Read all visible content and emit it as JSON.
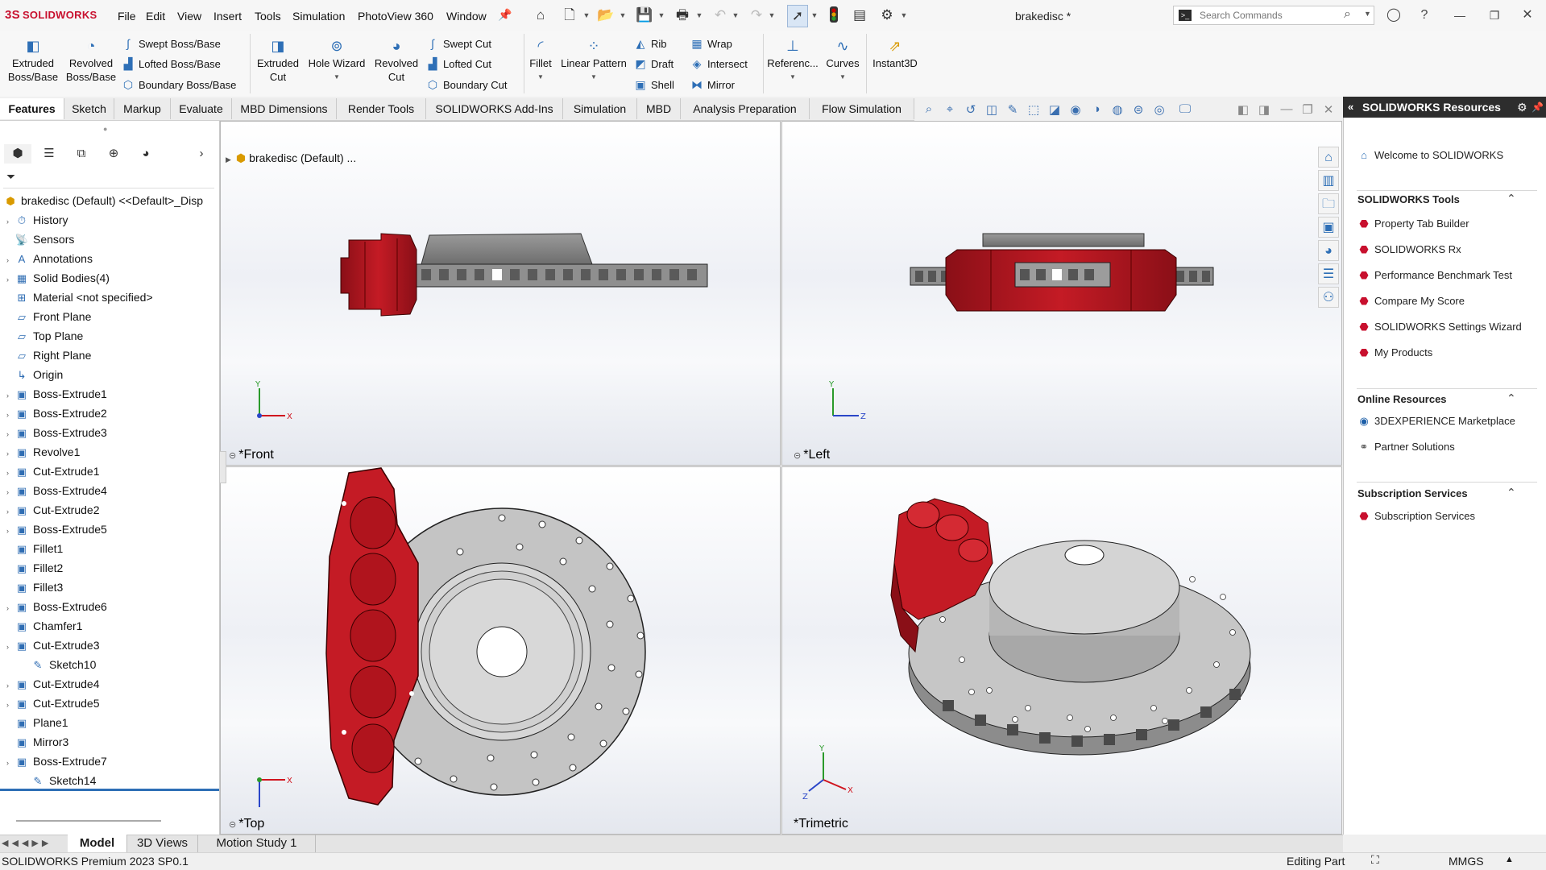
{
  "app": {
    "logo_prefix": "3S",
    "logo": "SOLIDWORKS",
    "doc_title": "brakedisc *",
    "search_placeholder": "Search Commands"
  },
  "menu": [
    "File",
    "Edit",
    "View",
    "Insert",
    "Tools",
    "Simulation",
    "PhotoView 360",
    "Window"
  ],
  "ribbon": {
    "extruded_boss": [
      "Extruded",
      "Boss/Base"
    ],
    "revolved_boss": [
      "Revolved",
      "Boss/Base"
    ],
    "swept_boss": "Swept Boss/Base",
    "lofted_boss": "Lofted Boss/Base",
    "boundary_boss": "Boundary Boss/Base",
    "extruded_cut": [
      "Extruded",
      "Cut"
    ],
    "hole_wizard": "Hole Wizard",
    "revolved_cut": [
      "Revolved",
      "Cut"
    ],
    "swept_cut": "Swept Cut",
    "lofted_cut": "Lofted Cut",
    "boundary_cut": "Boundary Cut",
    "fillet": "Fillet",
    "linear_pattern": "Linear Pattern",
    "rib": "Rib",
    "draft": "Draft",
    "shell": "Shell",
    "wrap": "Wrap",
    "intersect": "Intersect",
    "mirror": "Mirror",
    "reference": "Referenc...",
    "curves": "Curves",
    "instant3d": "Instant3D"
  },
  "cm_tabs": [
    "Features",
    "Sketch",
    "Markup",
    "Evaluate",
    "MBD Dimensions",
    "Render Tools",
    "SOLIDWORKS Add-Ins",
    "Simulation",
    "MBD",
    "Analysis Preparation",
    "Flow Simulation"
  ],
  "tree": {
    "root": "brakedisc (Default) <<Default>_Disp",
    "items": [
      {
        "label": "History",
        "expand": true
      },
      {
        "label": "Sensors",
        "expand": false
      },
      {
        "label": "Annotations",
        "expand": true
      },
      {
        "label": "Solid Bodies(4)",
        "expand": true
      },
      {
        "label": "Material <not specified>",
        "expand": false
      },
      {
        "label": "Front Plane",
        "expand": false
      },
      {
        "label": "Top Plane",
        "expand": false
      },
      {
        "label": "Right Plane",
        "expand": false
      },
      {
        "label": "Origin",
        "expand": false
      },
      {
        "label": "Boss-Extrude1",
        "expand": true
      },
      {
        "label": "Boss-Extrude2",
        "expand": true
      },
      {
        "label": "Boss-Extrude3",
        "expand": true
      },
      {
        "label": "Revolve1",
        "expand": true
      },
      {
        "label": "Cut-Extrude1",
        "expand": true
      },
      {
        "label": "Boss-Extrude4",
        "expand": true
      },
      {
        "label": "Cut-Extrude2",
        "expand": true
      },
      {
        "label": "Boss-Extrude5",
        "expand": true
      },
      {
        "label": "Fillet1",
        "expand": false
      },
      {
        "label": "Fillet2",
        "expand": false
      },
      {
        "label": "Fillet3",
        "expand": false
      },
      {
        "label": "Boss-Extrude6",
        "expand": true
      },
      {
        "label": "Chamfer1",
        "expand": false
      },
      {
        "label": "Cut-Extrude3",
        "expand": true
      },
      {
        "label": "Sketch10",
        "expand": false,
        "child": true
      },
      {
        "label": "Cut-Extrude4",
        "expand": true
      },
      {
        "label": "Cut-Extrude5",
        "expand": true
      },
      {
        "label": "Plane1",
        "expand": false
      },
      {
        "label": "Mirror3",
        "expand": false
      },
      {
        "label": "Boss-Extrude7",
        "expand": true
      },
      {
        "label": "Sketch14",
        "expand": false,
        "child": true
      }
    ]
  },
  "viewports": {
    "front": "*Front",
    "left": "*Left",
    "top": "*Top",
    "trimetric": "*Trimetric",
    "flyout": "brakedisc (Default) ..."
  },
  "task_pane": {
    "title": "SOLIDWORKS Resources",
    "welcome": "Welcome to SOLIDWORKS",
    "tools_title": "SOLIDWORKS Tools",
    "tools": [
      "Property Tab Builder",
      "SOLIDWORKS Rx",
      "Performance Benchmark Test",
      "Compare My Score",
      "SOLIDWORKS Settings Wizard",
      "My Products"
    ],
    "online_title": "Online Resources",
    "online": [
      "3DEXPERIENCE Marketplace",
      "Partner Solutions"
    ],
    "subs_title": "Subscription Services",
    "subs": [
      "Subscription Services"
    ]
  },
  "bottom_tabs": [
    "Model",
    "3D Views",
    "Motion Study 1"
  ],
  "status": {
    "left": "SOLIDWORKS Premium 2023 SP0.1",
    "mode": "Editing Part",
    "units": "MMGS"
  },
  "colors": {
    "brand": "#c8102e",
    "caliper": "#b3141f",
    "disc": "#bfbfbf",
    "accent": "#2e6fb6"
  }
}
